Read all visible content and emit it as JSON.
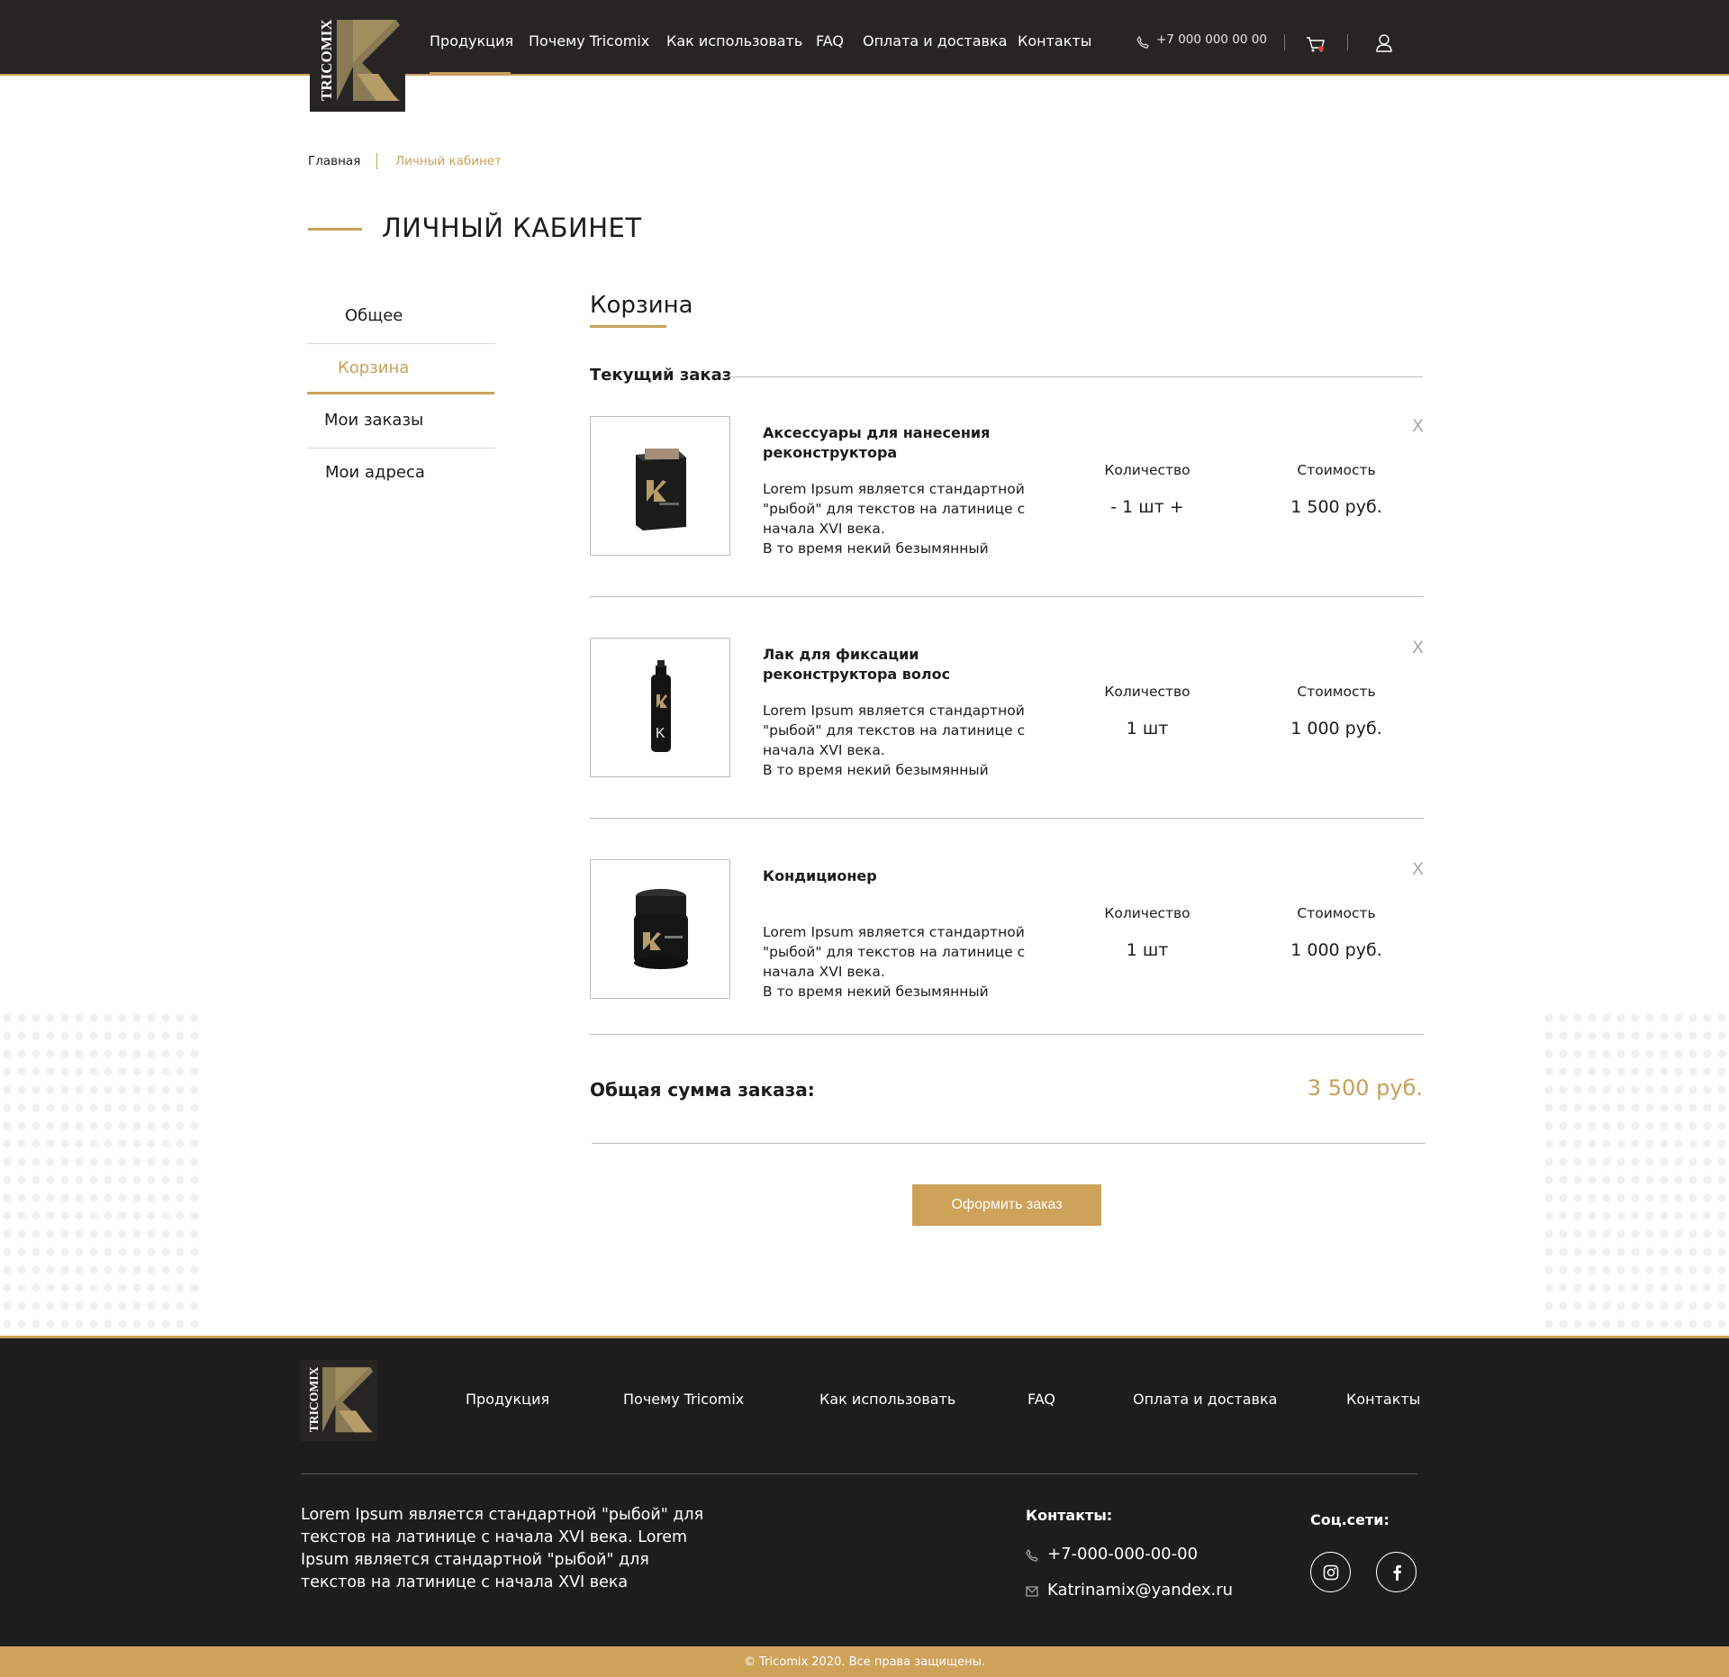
{
  "brand": {
    "name": "TRICOMIX",
    "accent": "#c9a05a",
    "dark": "#272524"
  },
  "header": {
    "nav": [
      "Продукция",
      "Почему Tricomix",
      "Как использовать",
      "FAQ",
      "Оплата и доставка",
      "Контакты"
    ],
    "active_nav": "Продукция",
    "phone": "+7 000 000 00 00",
    "icons": [
      "phone-icon",
      "cart-icon",
      "user-icon"
    ]
  },
  "breadcrumb": {
    "home": "Главная",
    "current": "Личный кабинет"
  },
  "page_title": "ЛИЧНЫЙ КАБИНЕТ",
  "sidebar": {
    "items": [
      {
        "label": "Общее"
      },
      {
        "label": "Корзина",
        "active": true
      },
      {
        "label": "Мои заказы"
      },
      {
        "label": "Мои адреса"
      }
    ]
  },
  "cart": {
    "title": "Корзина",
    "section": "Текущий заказ",
    "qty_label": "Количество",
    "price_label": "Стоимость",
    "remove_label": "X",
    "items": [
      {
        "name": "Аксессуары для нанесения реконструктора",
        "description": " Lorem Ipsum является стандартной \"рыбой\" для текстов на латинице с начала XVI века.\nВ то время некий безымянный",
        "quantity": "- 1 шт +",
        "price": "1 500 руб.",
        "image": "product-box-icon"
      },
      {
        "name": "Лак для фиксации реконструктора волос",
        "description": " Lorem Ipsum является стандартной \"рыбой\" для текстов на латинице с начала XVI века.\nВ то время некий безымянный",
        "quantity": "1 шт",
        "price": "1 000 руб.",
        "image": "spray-bottle-icon"
      },
      {
        "name": "Кондиционер",
        "description": " Lorem Ipsum является стандартной \"рыбой\" для текстов на латинице с начала XVI века.\nВ то время некий безымянный",
        "quantity": "1 шт",
        "price": "1 000 руб.",
        "image": "jar-icon"
      }
    ],
    "total_label": "Общая сумма заказа:",
    "total_value": "3 500 руб.",
    "checkout_label": "Оформить заказ"
  },
  "footer": {
    "nav": [
      "Продукция",
      "Почему Tricomix",
      "Как использовать",
      "FAQ",
      "Оплата и доставка",
      "Контакты"
    ],
    "description": " Lorem Ipsum является стандартной \"рыбой\" для текстов на латинице с начала XVI века. Lorem Ipsum является стандартной \"рыбой\" для текстов на латинице с начала XVI века",
    "contacts_title": "Контакты:",
    "phone": "+7-000-000-00-00",
    "email": "Katrinamix@yandex.ru",
    "social_title": "Соц.сети:",
    "social": [
      "instagram-icon",
      "facebook-icon"
    ],
    "copyright": "© Tricomix 2020. Все права защищены."
  }
}
